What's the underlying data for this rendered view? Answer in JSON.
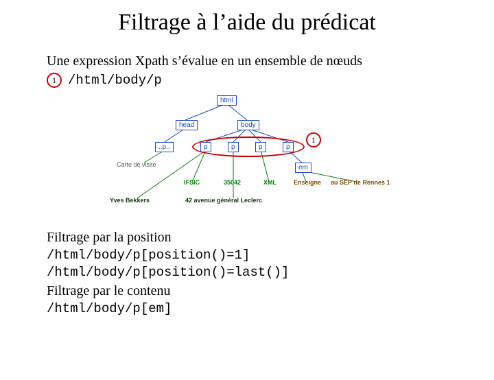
{
  "title": "Filtrage à l’aide du prédicat",
  "intro": {
    "line": "Une expression Xpath s’évalue en un ensemble de nœuds",
    "badge": "1",
    "xpath": "/html/body/p"
  },
  "diagram": {
    "root": "html",
    "level2": {
      "head": "head",
      "body": "body"
    },
    "head_children": {
      "p": "..p.."
    },
    "head_caption": "Carte de visite",
    "body_children": [
      "p",
      "p",
      "p",
      "p"
    ],
    "em_node": "em",
    "leaves_green": [
      "IFSIC",
      "35042",
      "XML"
    ],
    "leaves_dark": [
      "Yves Bekkers",
      "42 avenue général Leclerc"
    ],
    "em_children": [
      "Enseigne",
      "au SEP de Rennes 1"
    ],
    "badge": "1"
  },
  "section2": {
    "heading1": "Filtrage par la position",
    "code1": "/html/body/p[position()=1]",
    "code2": "/html/body/p[position()=last()]",
    "heading2": "Filtrage par le contenu",
    "code3": "/html/body/p[em]"
  }
}
